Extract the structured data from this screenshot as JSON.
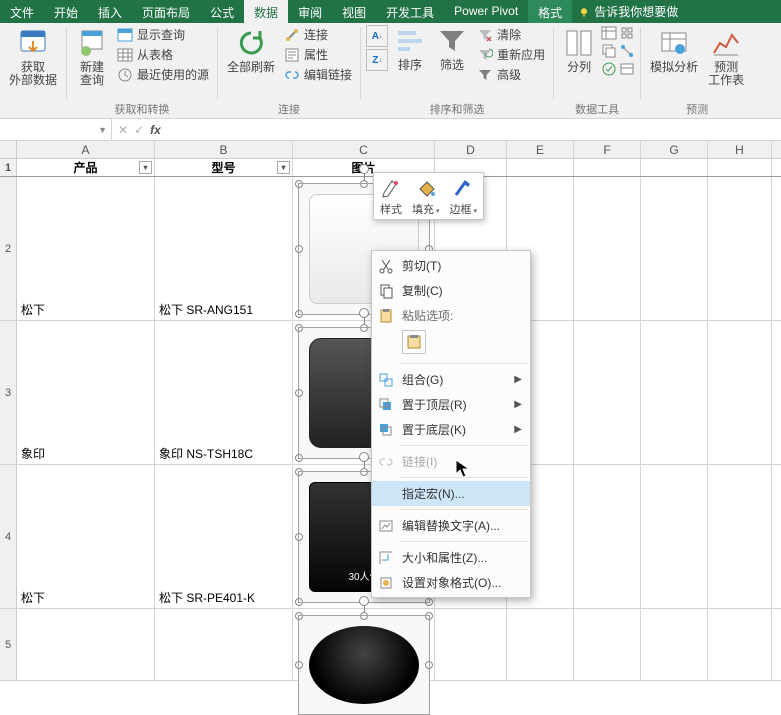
{
  "ribbonTabs": {
    "file": "文件",
    "home": "开始",
    "insert": "插入",
    "pageLayout": "页面布局",
    "formulas": "公式",
    "data": "数据",
    "review": "审阅",
    "view": "视图",
    "dev": "开发工具",
    "powerpivot": "Power Pivot",
    "format": "格式",
    "tellMe": "告诉我你想要做"
  },
  "ribbon": {
    "getData": {
      "label": "获取\n外部数据"
    },
    "newQuery": {
      "label": "新建\n查询"
    },
    "showQueries": "显示查询",
    "fromTable": "从表格",
    "recentSources": "最近使用的源",
    "refreshAll": {
      "label": "全部刷新"
    },
    "connections": "连接",
    "properties": "属性",
    "editLinks": "编辑链接",
    "sortLabel": "排序",
    "filterLabel": "筛选",
    "clear": "清除",
    "reapply": "重新应用",
    "advanced": "高级",
    "columns": {
      "label": "分列"
    },
    "whatIf": {
      "label": "模拟分析"
    },
    "forecast": {
      "label": "预测\n工作表"
    },
    "group_getTransform": "获取和转换",
    "group_connections": "连接",
    "group_sortFilter": "排序和筛选",
    "group_dataTools": "数据工具",
    "group_forecast": "预测"
  },
  "fx": {
    "nameBox": "",
    "fxSymbol": "fx"
  },
  "columns": {
    "A": "A",
    "B": "B",
    "C": "C",
    "D": "D",
    "E": "E",
    "F": "F",
    "G": "G",
    "H": "H"
  },
  "table": {
    "headers": {
      "product": "产品",
      "model": "型号",
      "image": "图片"
    },
    "rows": [
      {
        "num": "1"
      },
      {
        "num": "2",
        "product": "松下",
        "model": "松下 SR-ANG151"
      },
      {
        "num": "3",
        "product": "象印",
        "model": "象印 NS-TSH18C"
      },
      {
        "num": "4",
        "product": "松下",
        "model": "松下 SR-PE401-K"
      },
      {
        "num": "5"
      }
    ]
  },
  "miniToolbar": {
    "style": "样式",
    "fill": "填充",
    "outline": "边框"
  },
  "ctx": {
    "cut": "剪切(T)",
    "copy": "复制(C)",
    "pasteHeader": "粘贴选项:",
    "group": "组合(G)",
    "bringFront": "置于顶层(R)",
    "sendBack": "置于底层(K)",
    "link": "链接(I)",
    "assignMacro": "指定宏(N)...",
    "altText": "编辑替换文字(A)...",
    "sizeProps": "大小和属性(Z)...",
    "formatObject": "设置对象格式(O)..."
  },
  "productTag": "30人份"
}
